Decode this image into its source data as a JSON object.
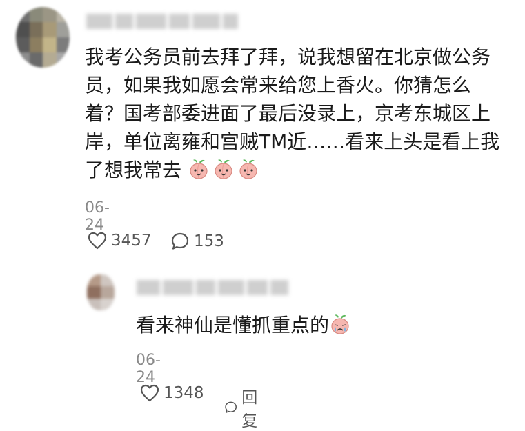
{
  "main_comment": {
    "text_lines": [
      "我考公务员前去拜了拜，说我想留在北京做公务",
      "员，如果我如愿会常来给您上香火。你猜怎么",
      "着？国考部委进面了最后没录上，京考东城区上",
      "岸，单位离雍和宫贼TM近……看来上头是看上我",
      "了想我常去"
    ],
    "emoji": [
      "peach-smile-emoji",
      "peach-smile-emoji",
      "peach-smile-emoji"
    ],
    "date": "06-24",
    "likes": "3457",
    "replies": "153"
  },
  "reply": {
    "text": "看来神仙是懂抓重点的",
    "emoji": [
      "peach-crying-emoji"
    ],
    "date": "06-24",
    "likes": "1348",
    "reply_label": "回复"
  },
  "icons": {
    "like": "heart-outline-icon",
    "comment": "speech-bubble-icon"
  },
  "colors": {
    "text": "#1b1b1b",
    "meta": "#8a8a8a",
    "action": "#555555",
    "emoji_peach": "#f6b7b0",
    "emoji_leaf": "#5cb85c"
  }
}
